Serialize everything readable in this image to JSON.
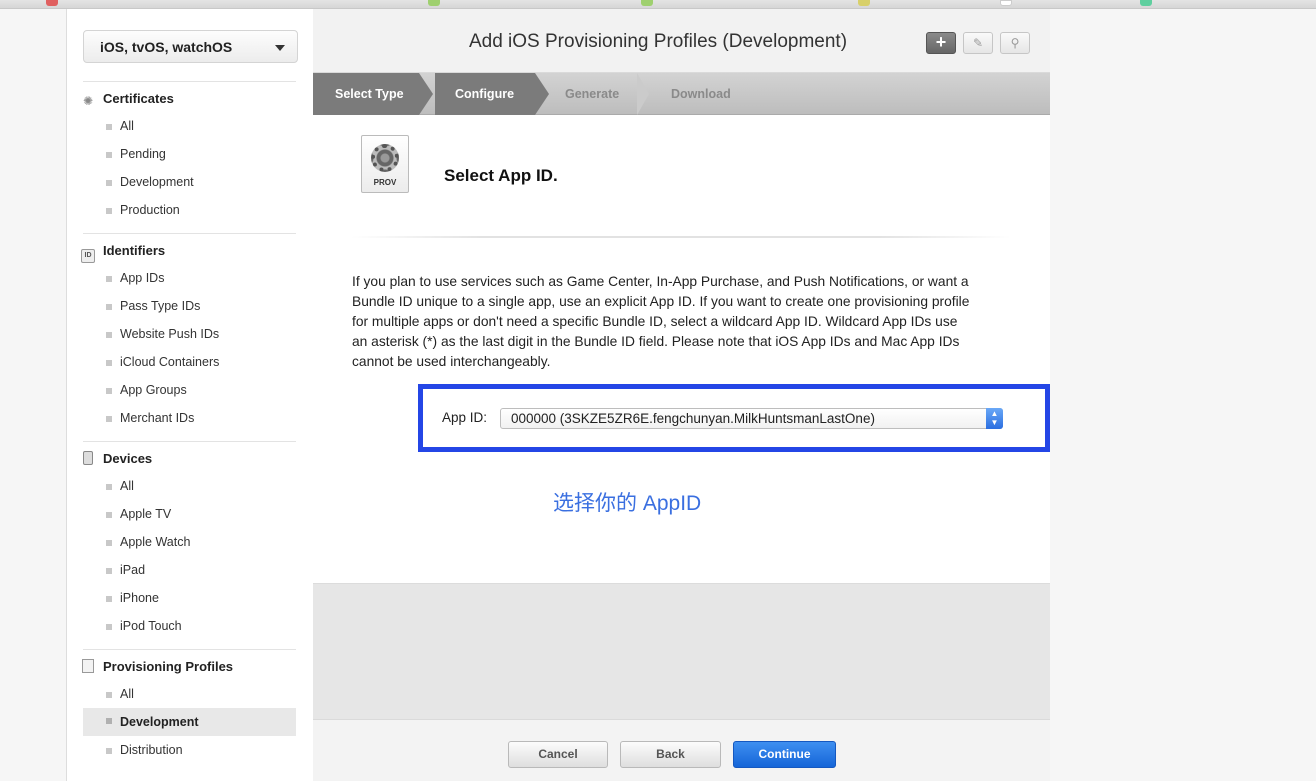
{
  "sidebar": {
    "platform": "iOS, tvOS, watchOS",
    "sections": [
      {
        "title": "Certificates",
        "icon": "certificate-icon",
        "items": [
          "All",
          "Pending",
          "Development",
          "Production"
        ]
      },
      {
        "title": "Identifiers",
        "icon": "id-icon",
        "icon_text": "ID",
        "items": [
          "App IDs",
          "Pass Type IDs",
          "Website Push IDs",
          "iCloud Containers",
          "App Groups",
          "Merchant IDs"
        ]
      },
      {
        "title": "Devices",
        "icon": "device-icon",
        "items": [
          "All",
          "Apple TV",
          "Apple Watch",
          "iPad",
          "iPhone",
          "iPod Touch"
        ]
      },
      {
        "title": "Provisioning Profiles",
        "icon": "document-icon",
        "items": [
          "All",
          "Development",
          "Distribution"
        ],
        "active_item": "Development"
      }
    ]
  },
  "header": {
    "title": "Add iOS Provisioning Profiles (Development)",
    "add_icon": "+",
    "edit_icon": "edit-icon",
    "search_icon": "search-icon"
  },
  "steps": [
    "Select Type",
    "Configure",
    "Generate",
    "Download"
  ],
  "active_step": "Configure",
  "content": {
    "icon_label": "PROV",
    "heading": "Select App ID.",
    "description": "If you plan to use services such as Game Center, In-App Purchase, and Push Notifications, or want a Bundle ID unique to a single app, use an explicit App ID. If you want to create one provisioning profile for multiple apps or don't need a specific Bundle ID, select a wildcard App ID. Wildcard App IDs use an asterisk (*) as the last digit in the Bundle ID field. Please note that iOS App IDs and Mac App IDs cannot be used interchangeably.",
    "app_id_label": "App ID:",
    "app_id_value": "000000 (3SKZE5ZR6E.fengchunyan.MilkHuntsmanLastOne)",
    "annotation": "选择你的 AppID",
    "annotation_color": "#3a6fe0",
    "highlight_color": "#2446e6"
  },
  "footer": {
    "cancel": "Cancel",
    "back": "Back",
    "continue": "Continue"
  }
}
